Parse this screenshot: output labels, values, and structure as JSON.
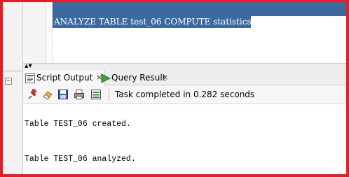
{
  "editor": {
    "selected_statement": "ANALYZE TABLE test_06 COMPUTE statistics"
  },
  "splitter": {
    "arrows": "▲▼"
  },
  "left_panel": {
    "collapse_glyph": "−"
  },
  "tabs": [
    {
      "label": "Script Output",
      "close": "×",
      "active": true
    },
    {
      "label": "Query Result",
      "close": "×",
      "active": false
    }
  ],
  "toolbar": {
    "status": "Task completed in 0.282 seconds",
    "icons": [
      "pin-icon",
      "eraser-icon",
      "save-icon",
      "print-icon",
      "export-icon"
    ]
  },
  "output": {
    "lines": [
      "Table TEST_06 created.",
      "Table TEST_06 analyzed."
    ]
  },
  "colors": {
    "selection": "#3b6aa0",
    "frame": "#e81c24"
  }
}
